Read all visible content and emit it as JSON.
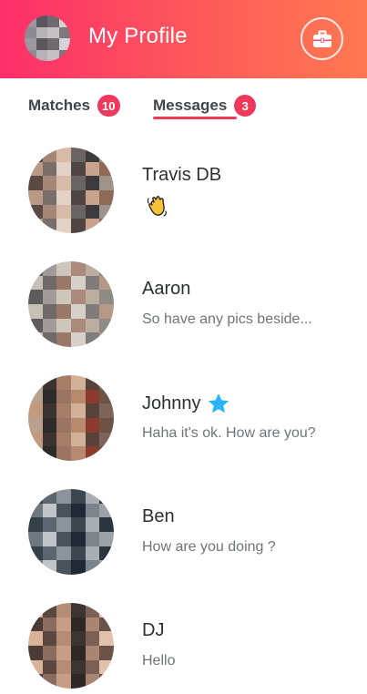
{
  "header": {
    "title": "My Profile",
    "avatar_icon": "avatar-pixelated",
    "briefcase_icon": "briefcase-icon",
    "gradient_start": "#fd2e6a",
    "gradient_end": "#ff7950"
  },
  "tabs": [
    {
      "label": "Matches",
      "count": "10"
    },
    {
      "label": "Messages",
      "count": "3",
      "active": true
    }
  ],
  "accent": "#ed3a5c",
  "messages": [
    {
      "name": "Travis DB",
      "preview": "",
      "preview_icon": "waving-hand-emoji"
    },
    {
      "name": "Aaron",
      "preview": "So have any pics beside..."
    },
    {
      "name": "Johnny",
      "preview": "Haha it's ok. How are you?",
      "badge_icon": "star-icon"
    },
    {
      "name": "Ben",
      "preview": "How are you doing ?"
    },
    {
      "name": "DJ",
      "preview": "Hello"
    }
  ]
}
